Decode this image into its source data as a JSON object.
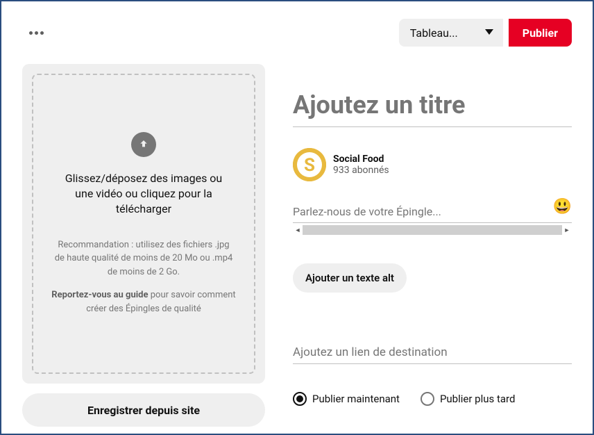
{
  "topbar": {
    "board_select": "Tableau...",
    "publish": "Publier"
  },
  "upload": {
    "main_text": "Glissez/déposez des images ou une vidéo ou cliquez pour la télécharger",
    "recommendation": "Recommandation : utilisez des fichiers .jpg de haute qualité de moins de 20 Mo ou .mp4 de moins de 2 Go.",
    "guide_bold": "Reportez-vous au guide",
    "guide_rest": " pour savoir comment créer des Épingles de qualité"
  },
  "save_from_site": "Enregistrer depuis site",
  "form": {
    "title_placeholder": "Ajoutez un titre",
    "author_name": "Social Food",
    "author_sub": "933 abonnés",
    "desc_placeholder": "Parlez-nous de votre Épingle...",
    "alt_button": "Ajouter un texte alt",
    "dest_placeholder": "Ajoutez un lien de destination"
  },
  "schedule": {
    "now": "Publier maintenant",
    "later": "Publier plus tard"
  }
}
